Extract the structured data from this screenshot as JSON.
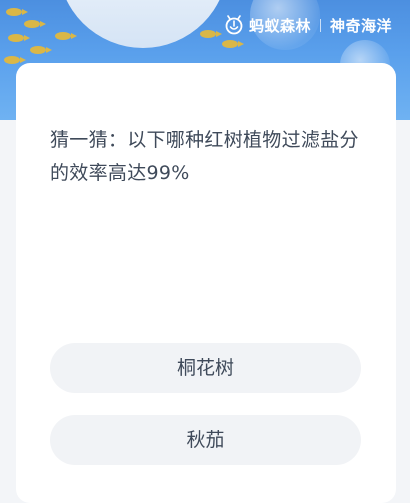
{
  "header": {
    "brand_name": "蚂蚁森林",
    "section_name": "神奇海洋",
    "logo_icon": "ant-forest-logo-icon"
  },
  "quiz": {
    "question": "猜一猜：以下哪种红树植物过滤盐分的效率高达99%",
    "options": [
      {
        "label": "桐花树"
      },
      {
        "label": "秋茄"
      }
    ]
  },
  "colors": {
    "banner": "#5aa0ec",
    "fish": "#e2b93f",
    "card": "#ffffff",
    "page": "#f3f5f8",
    "option_bg": "#f1f3f6",
    "text": "#3f4a5a"
  }
}
